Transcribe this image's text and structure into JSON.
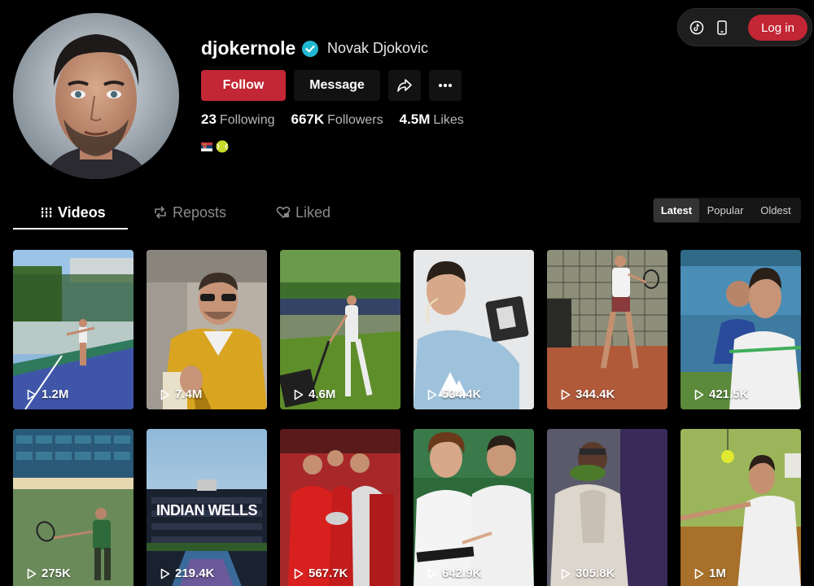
{
  "toolbar": {
    "tiktok_icon": "tiktok-logo-icon",
    "device_icon": "mobile-device-icon",
    "login_label": "Log in"
  },
  "profile": {
    "username": "djokernole",
    "display_name": "Novak Djokovic",
    "verified": true,
    "follow_label": "Follow",
    "message_label": "Message",
    "stats": [
      {
        "value": "23",
        "label": "Following"
      },
      {
        "value": "667K",
        "label": "Followers"
      },
      {
        "value": "4.5M",
        "label": "Likes"
      }
    ],
    "bio_emoji": [
      "serbia-flag-icon",
      "tennis-ball-icon"
    ]
  },
  "tabs": [
    {
      "label": "Videos",
      "icon": "grid-icon",
      "active": true
    },
    {
      "label": "Reposts",
      "icon": "repost-icon",
      "active": false
    },
    {
      "label": "Liked",
      "icon": "heart-lock-icon",
      "active": false
    }
  ],
  "sort": {
    "options": [
      "Latest",
      "Popular",
      "Oldest"
    ],
    "selected": "Latest"
  },
  "videos": [
    {
      "views": "1.2M"
    },
    {
      "views": "7.4M"
    },
    {
      "views": "4.6M"
    },
    {
      "views": "534.4K"
    },
    {
      "views": "344.4K"
    },
    {
      "views": "421.5K"
    },
    {
      "views": "275K"
    },
    {
      "views": "219.4K",
      "overlay_text": "INDIAN WELLS"
    },
    {
      "views": "567.7K"
    },
    {
      "views": "642.9K"
    },
    {
      "views": "305.8K"
    },
    {
      "views": "1M"
    }
  ],
  "colors": {
    "accent": "#c32634",
    "background": "#000000",
    "verified": "#20b8d0"
  }
}
